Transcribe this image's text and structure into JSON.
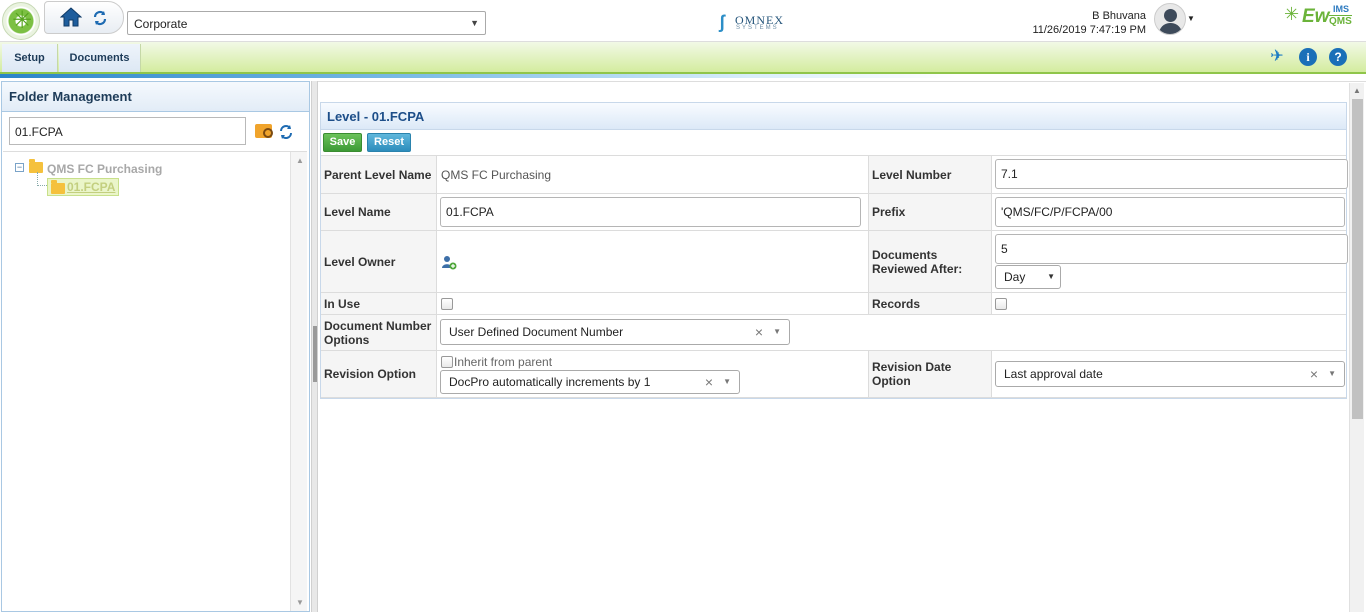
{
  "header": {
    "org_select_value": "Corporate",
    "omnex_name": "OMNEX",
    "omnex_sub": "SYSTEMS",
    "user_name": "B Bhuvana",
    "datetime": "11/26/2019 7:47:19 PM",
    "brand_ew": "Ew",
    "brand_ims": "IMS",
    "brand_qms": "QMS"
  },
  "menu": {
    "items": [
      {
        "label": "Setup"
      },
      {
        "label": "Documents"
      }
    ]
  },
  "folder_panel": {
    "title": "Folder Management",
    "search_value": "01.FCPA",
    "tree": {
      "root_label": "QMS FC Purchasing",
      "child_label": "01.FCPA"
    }
  },
  "form": {
    "title": "Level - 01.FCPA",
    "save_label": "Save",
    "reset_label": "Reset",
    "parent_level_name_label": "Parent Level Name",
    "parent_level_name_value": "QMS FC Purchasing",
    "level_number_label": "Level Number",
    "level_number_value": "7.1",
    "level_name_label": "Level Name",
    "level_name_value": "01.FCPA",
    "prefix_label": "Prefix",
    "prefix_value": "'QMS/FC/P/FCPA/00",
    "level_owner_label": "Level Owner",
    "documents_reviewed_after_label": "Documents Reviewed After:",
    "documents_reviewed_after_value": "5",
    "review_unit_value": "Day",
    "in_use_label": "In Use",
    "records_label": "Records",
    "document_number_options_label": "Document Number Options",
    "document_number_options_value": "User Defined Document Number",
    "revision_option_label": "Revision Option",
    "inherit_from_parent_label": "Inherit from parent",
    "revision_option_value": "DocPro automatically increments by 1",
    "revision_date_option_label": "Revision Date Option",
    "revision_date_option_value": "Last approval date"
  },
  "colors": {
    "menu_bar": "#d4ec9f",
    "title_text": "#1d4e89",
    "save_button": "#3c9a36",
    "reset_button": "#2d8dbc",
    "brand_green": "#6bb33a",
    "brand_blue": "#2e7bc0"
  },
  "icons": {
    "app_logo": "green-starburst-logo",
    "home": "home-icon",
    "refresh": "refresh-icon",
    "pin": "pin-icon",
    "info": "info-icon",
    "help": "help-icon",
    "folder_search": "folder-search-icon",
    "owner": "add-user-icon"
  }
}
